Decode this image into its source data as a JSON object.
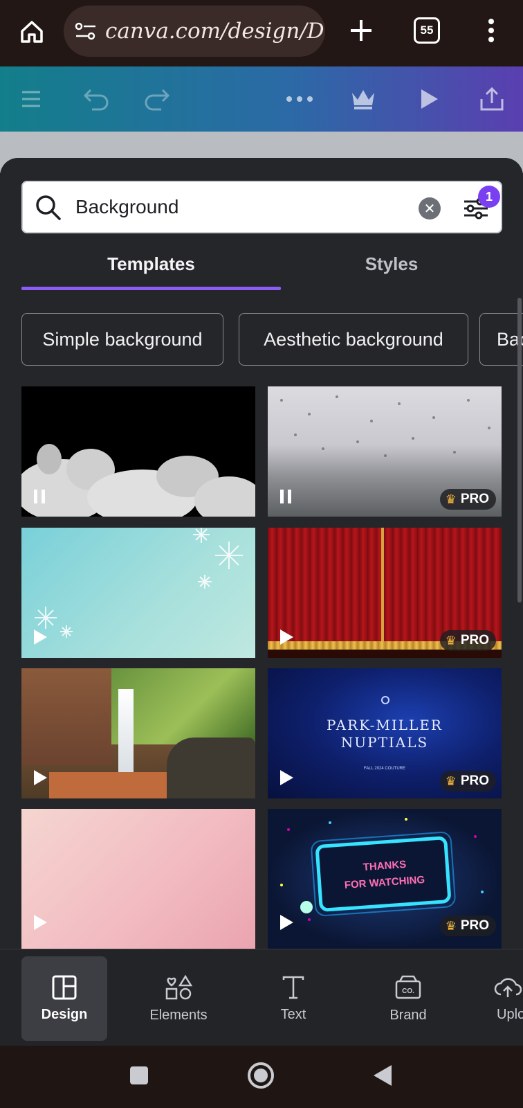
{
  "browser": {
    "url": "canva.com/design/D",
    "tab_count": "55"
  },
  "search": {
    "value": "Background",
    "filter_badge": "1"
  },
  "tabs": [
    {
      "label": "Templates",
      "active": true
    },
    {
      "label": "Styles",
      "active": false
    }
  ],
  "chips": [
    "Simple background",
    "Aesthetic background",
    "Bac"
  ],
  "templates": [
    {
      "icon": "pause-icon",
      "pro": false
    },
    {
      "icon": "pause-icon",
      "pro": true
    },
    {
      "icon": "play-icon",
      "pro": false
    },
    {
      "icon": "play-icon",
      "pro": true
    },
    {
      "icon": "play-icon",
      "pro": false
    },
    {
      "icon": "play-icon",
      "pro": true,
      "title_line1": "PARK-MILLER",
      "title_line2": "NUPTIALS",
      "subtitle": "FALL 2024 COUTURE"
    },
    {
      "icon": "play-icon",
      "pro": false
    },
    {
      "icon": "play-icon",
      "pro": true,
      "title_line1": "THANKS",
      "title_line2": "FOR WATCHING"
    }
  ],
  "pro_label": "PRO",
  "bottom_nav": [
    {
      "label": "Design",
      "active": true
    },
    {
      "label": "Elements",
      "active": false
    },
    {
      "label": "Text",
      "active": false
    },
    {
      "label": "Brand",
      "active": false
    },
    {
      "label": "Uplo",
      "active": false
    }
  ],
  "brand_icon_text": "CO."
}
